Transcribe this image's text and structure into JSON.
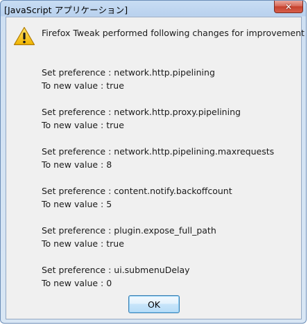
{
  "window": {
    "title": "[JavaScript アプリケーション]",
    "close_glyph": "✕"
  },
  "dialog": {
    "icon": "warning-icon",
    "heading": "Firefox Tweak performed following changes for improvement :",
    "changes": [
      {
        "pref": "Set preference : network.http.pipelining",
        "value": "To new value : true"
      },
      {
        "pref": "Set preference : network.http.proxy.pipelining",
        "value": "To new value : true"
      },
      {
        "pref": "Set preference : network.http.pipelining.maxrequests",
        "value": "To new value : 8"
      },
      {
        "pref": "Set preference : content.notify.backoffcount",
        "value": "To new value : 5"
      },
      {
        "pref": "Set preference : plugin.expose_full_path",
        "value": "To new value : true"
      },
      {
        "pref": "Set preference : ui.submenuDelay",
        "value": "To new value : 0"
      }
    ],
    "ok_label": "OK"
  },
  "colors": {
    "warning_fill": "#f6c400",
    "close_red": "#c6412d",
    "frame": "#b9d1ee"
  }
}
